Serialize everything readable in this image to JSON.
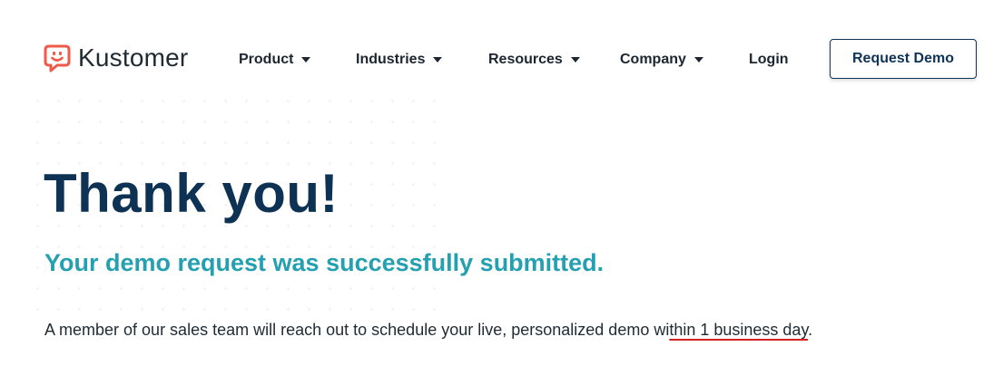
{
  "brand": {
    "name": "Kustomer",
    "accent_color": "#ef5a49"
  },
  "nav": {
    "items": [
      {
        "label": "Product"
      },
      {
        "label": "Industries"
      },
      {
        "label": "Resources"
      },
      {
        "label": "Company"
      }
    ],
    "login_label": "Login",
    "cta_label": "Request Demo"
  },
  "main": {
    "title": "Thank you!",
    "subtitle": "Your demo request was successfully submitted.",
    "message_before": "A member of our sales team will reach out to schedule your live, personalized demo wi",
    "message_highlight": "thin 1 business day",
    "message_after": "."
  },
  "colors": {
    "title": "#0d3253",
    "subtitle": "#24a0b1",
    "annotation_underline": "#d42020"
  }
}
